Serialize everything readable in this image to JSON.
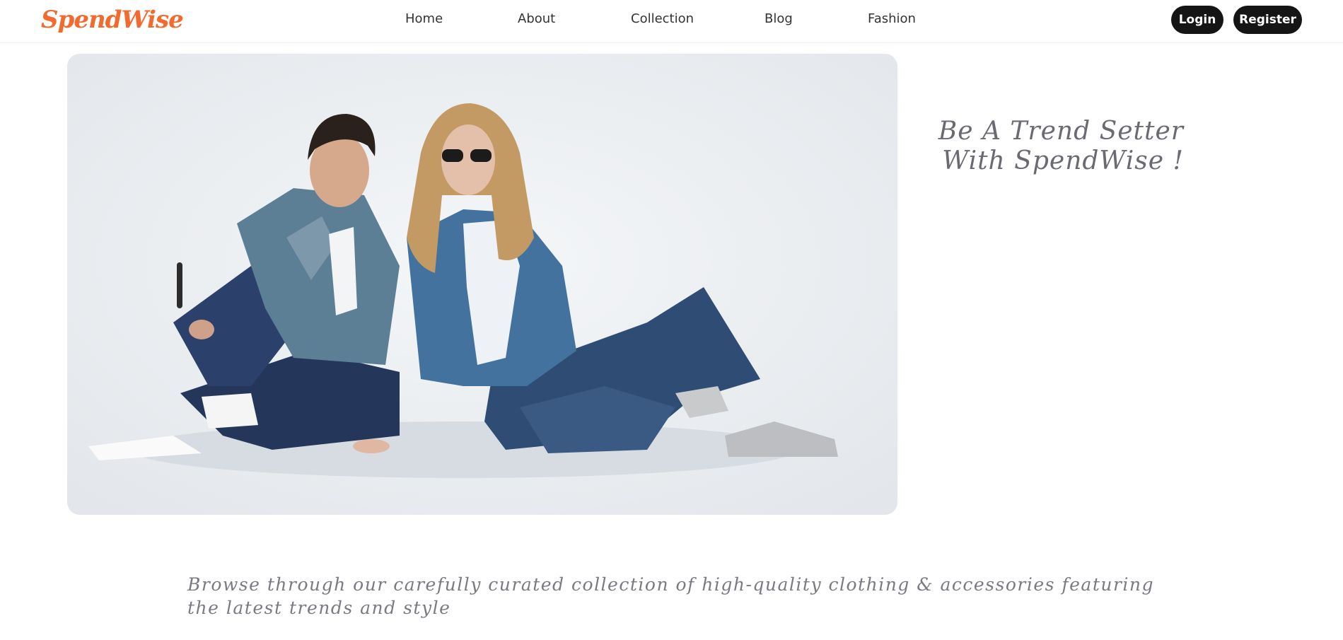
{
  "brand": {
    "name": "SpendWise",
    "color": "#f26a2e"
  },
  "nav": {
    "links": [
      "Home",
      "About",
      "Collection",
      "Blog",
      "Fashion"
    ],
    "login_label": "Login",
    "register_label": "Register"
  },
  "hero": {
    "image_description": "",
    "tagline": "Be A Trend Setter With SpendWise !"
  },
  "description": "Browse through our carefully curated collection of high-quality clothing & accessories featuring the latest trends and style",
  "colors": {
    "button_bg": "#151515",
    "text_muted": "#6a6a72",
    "hero_bg": "#e9ecf0"
  }
}
